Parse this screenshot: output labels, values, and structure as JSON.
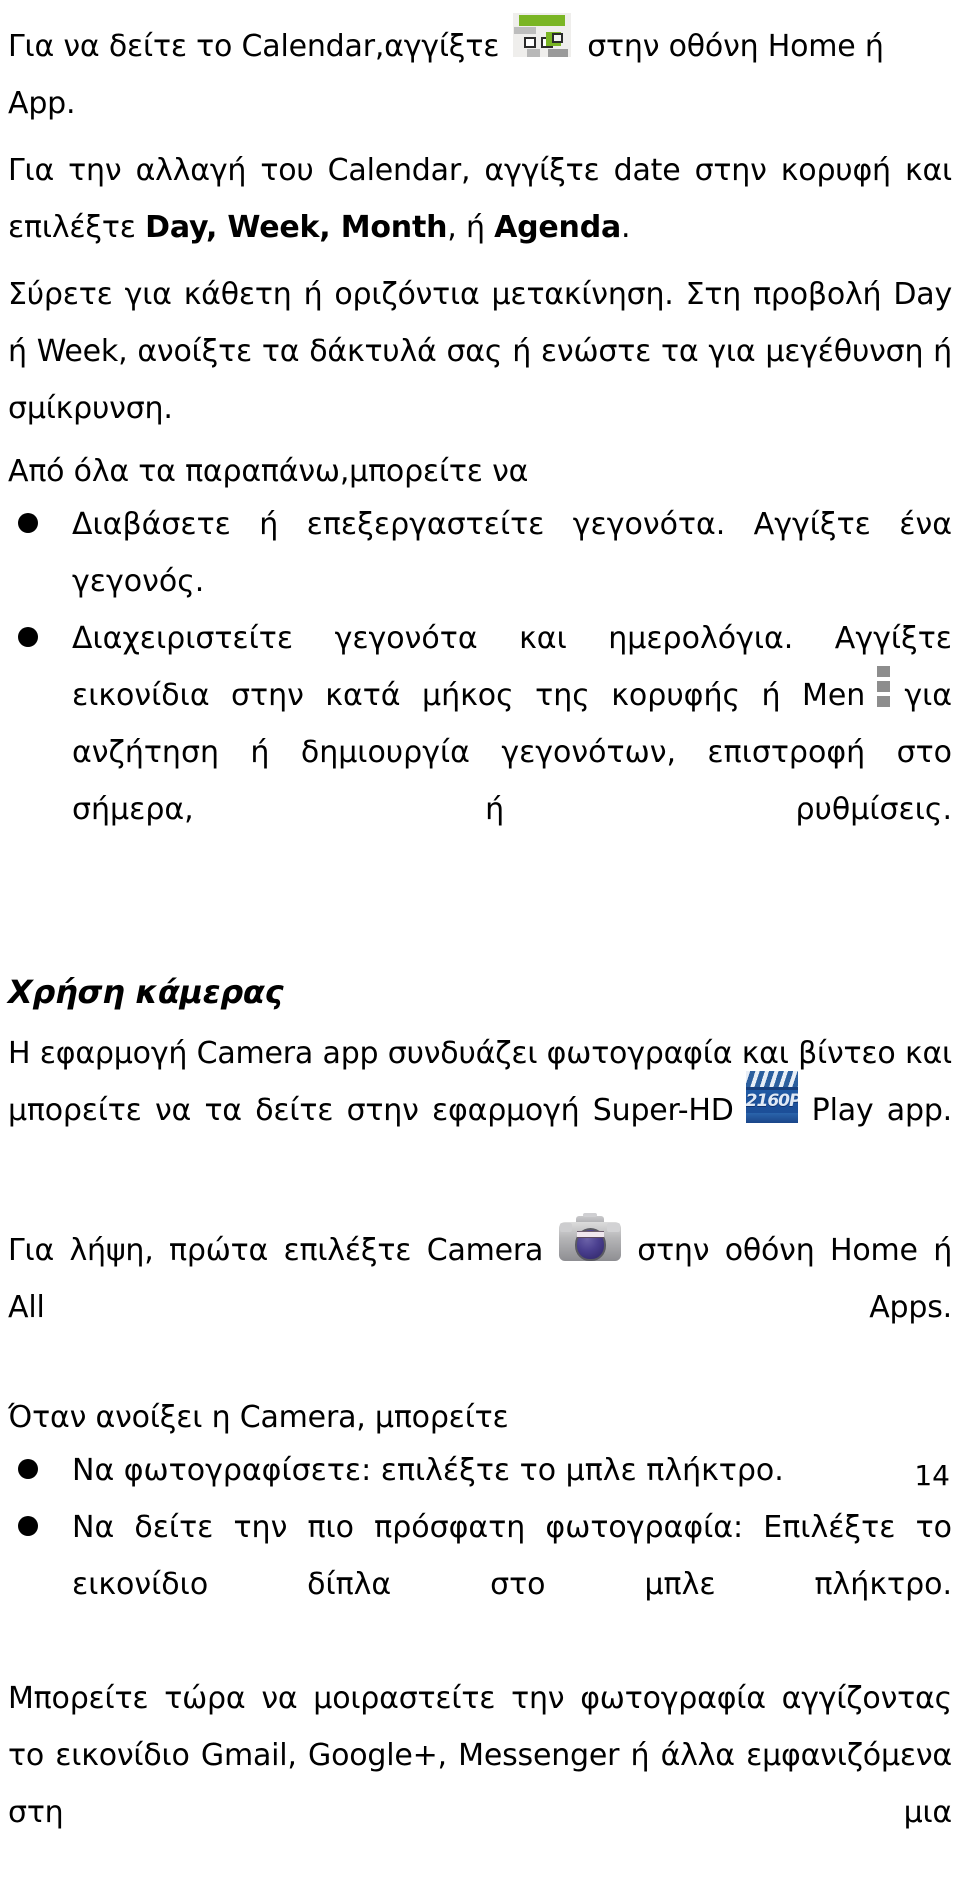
{
  "document": {
    "language": "el",
    "page_number": "14",
    "background_color": "#ffffff",
    "text_color": "#000000"
  },
  "icons": {
    "calendar": {
      "name": "calendar-app-icon",
      "colors": {
        "accent": "#7ab524",
        "base": "#efeeec",
        "gray": "#bdbdbd"
      }
    },
    "menu": {
      "name": "overflow-menu-icon",
      "colors": {
        "dot": "#8d8d8d"
      }
    },
    "superhd": {
      "name": "super-hd-player-icon",
      "label": "2160P",
      "colors": {
        "base": "#1e56a0",
        "stripe": "#e8eef6"
      }
    },
    "camera": {
      "name": "camera-app-icon",
      "colors": {
        "body": "#b6b6b8",
        "lens": "#4a3f8f"
      }
    }
  },
  "content": {
    "calendar_section": {
      "line1_before_icon": "Για να δείτε το Calendar,αγγίξτε",
      "line1_after_icon": "στην οθόνη Home ή App.",
      "para2_a": "Για την αλλαγή του Calendar, αγγίξτε date στην κορυφή και επιλέξτε ",
      "para2_bold1": "Day, Week, Month",
      "para2_mid": ", ή ",
      "para2_bold2": "Agenda",
      "para2_end": ".",
      "para3": "Σύρετε για κάθετη ή οριζόντια μετακίνηση. Στη προβολή Day ή Week, ανοίξτε τα δάκτυλά σας ή ενώστε τα για μεγέθυνση ή σμίκρυνση.",
      "para4": "Από όλα τα παραπάνω,μπορείτε να",
      "bullet1": "Διαβάσετε ή   επεξεργαστείτε γεγονότα. Αγγίξτε ένα γεγονός.",
      "bullet2_a": "Διαχειριστείτε γεγονότα και ημερολόγια. Αγγίξτε εικονίδια στην κατά μήκος της κορυφής ή Men",
      "bullet2_b": "για ανζήτηση ή δημιουργία γεγονότων, επιστροφή στο σήμερα, ή ρυθμίσεις."
    },
    "camera_section": {
      "heading": "Χρήση κάμερας",
      "para1_before_icon": "Η εφαρμογή Camera app συνδυάζει φωτογραφία και βίντεο και μπορείτε να τα δείτε στην εφαρμογή Super-HD",
      "para1_after_icon": "Play app.",
      "para2_before_icon": "Για λήψη, πρώτα επιλέξτε Camera",
      "para2_after_icon": "στην οθόνη Home ή All Apps.",
      "para3": "Όταν ανοίξει η Camera, μπορείτε",
      "bullet1": "Να φωτογραφίσετε: επιλέξτε το μπλε πλήκτρο.",
      "bullet2": "Να δείτε την πιο πρόσφατη φωτογραφία: Επιλέξτε το εικονίδιο δίπλα στο μπλε πλήκτρο.",
      "para4": "Μπορείτε τώρα να μοιραστείτε την φωτογραφία αγγίζοντας το εικονίδιο Gmail, Google+, Messenger ή άλλα εμφανιζόμενα στη μια"
    }
  }
}
